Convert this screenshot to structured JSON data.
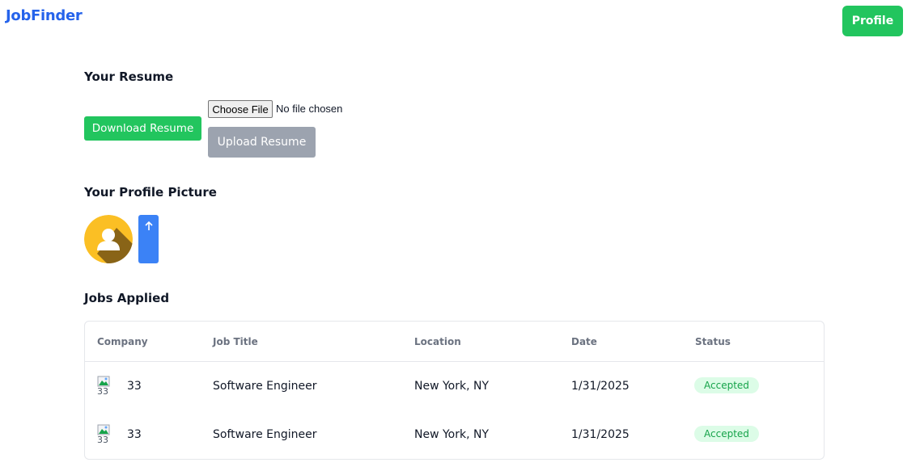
{
  "header": {
    "brand": "JobFinder",
    "profile_label": "Profile"
  },
  "resume": {
    "title": "Your Resume",
    "download_label": "Download Resume",
    "choose_file_label": "Choose File",
    "file_status": "No file chosen",
    "upload_label": "Upload Resume"
  },
  "profile_picture": {
    "title": "Your Profile Picture",
    "upload_icon": "arrow-up-icon"
  },
  "jobs": {
    "title": "Jobs Applied",
    "columns": [
      "Company",
      "Job Title",
      "Location",
      "Date",
      "Status"
    ],
    "rows": [
      {
        "logo_alt": "33",
        "company": "33",
        "job_title": "Software Engineer",
        "location": "New York, NY",
        "date": "1/31/2025",
        "status": "Accepted"
      },
      {
        "logo_alt": "33",
        "company": "33",
        "job_title": "Software Engineer",
        "location": "New York, NY",
        "date": "1/31/2025",
        "status": "Accepted"
      }
    ]
  },
  "colors": {
    "brand": "#2563eb",
    "primary_green": "#22c55e",
    "disabled_gray": "#9ca3af",
    "accent_blue": "#3b82f6",
    "status_bg": "#dcfce7",
    "status_text": "#16a34a"
  }
}
